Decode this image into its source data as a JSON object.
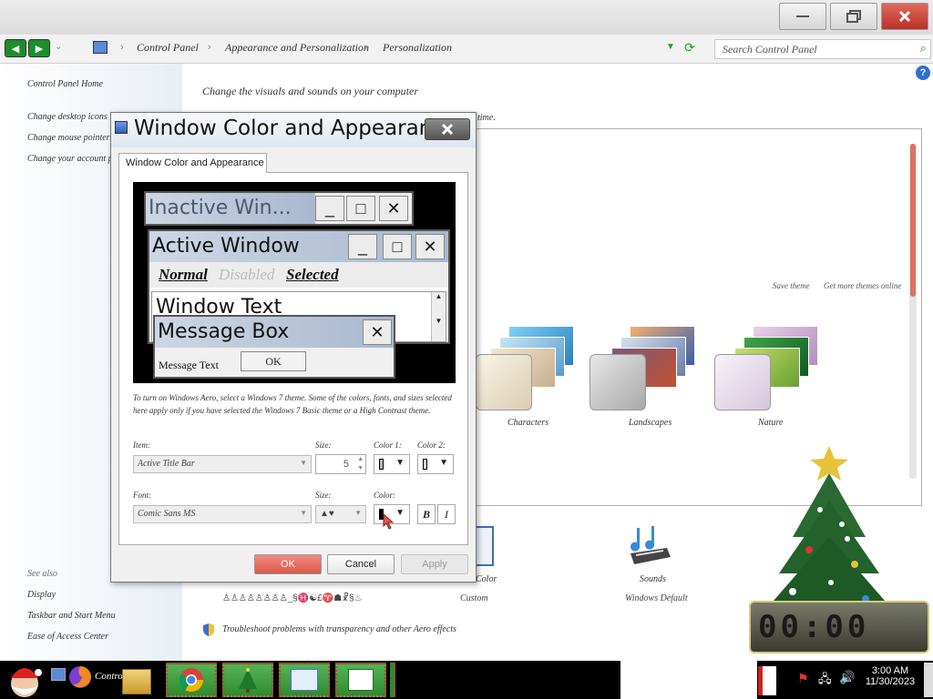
{
  "window": {
    "minimize_icon": "minimize-icon",
    "maximize_icon": "restore-icon",
    "close_icon": "close-icon"
  },
  "address": {
    "crumbs": [
      "Control Panel",
      "Appearance and Personalization",
      "Personalization"
    ],
    "search_placeholder": "Search Control Panel"
  },
  "left_pane": {
    "home": "Control Panel Home",
    "links": [
      "Change desktop icons",
      "Change mouse pointers",
      "Change your account picture"
    ],
    "see_also_label": "See also",
    "see_also": [
      "Display",
      "Taskbar and Start Menu",
      "Ease of Access Center"
    ]
  },
  "main": {
    "heading": "Change the visuals and sounds on your computer",
    "heading_suffix": "time.",
    "save_theme": "Save theme",
    "get_more_themes": "Get more themes online",
    "themes": [
      {
        "label": "Characters"
      },
      {
        "label": "Landscapes"
      },
      {
        "label": "Nature"
      }
    ],
    "bottom_items": [
      "Color",
      "Sounds"
    ],
    "bottom_sublabels": [
      "Custom",
      "Windows Default"
    ],
    "scrambled_label": "♙♙♙♙♙♙♙♙_§♓☯£♈☗☧§♨",
    "troubleshoot": "Troubleshoot problems with transparency and other Aero effects",
    "clock": "00:00"
  },
  "dialog": {
    "title": "Window Color and Appearance",
    "tab": "Window Color and Appearance",
    "preview": {
      "inactive_title": "Inactive Win...",
      "active_title": "Active Window",
      "menu": [
        "Normal",
        "Disabled",
        "Selected"
      ],
      "window_text": "Window Text",
      "message_title": "Message Box",
      "message_text": "Message Text",
      "message_ok": "OK"
    },
    "description": "To turn on Windows Aero, select a Windows 7 theme. Some of the colors, fonts, and sizes selected here apply only if you have selected the Windows 7 Basic theme or a High Contrast theme.",
    "item_label": "Item:",
    "item_value": "Active Title Bar",
    "size_label": "Size:",
    "size_value": "5",
    "color1_label": "Color 1:",
    "color2_label": "Color 2:",
    "font_label": "Font:",
    "font_value": "Comic Sans MS",
    "font_size_label": "Size:",
    "font_size_value": "▲♥",
    "font_color_label": "Color:",
    "bold_glyph": "B",
    "italic_glyph": "I",
    "ok": "OK",
    "cancel": "Cancel",
    "apply": "Apply"
  },
  "taskbar": {
    "active_label": "Control...",
    "time": "3:00 AM",
    "date": "11/30/2023"
  }
}
